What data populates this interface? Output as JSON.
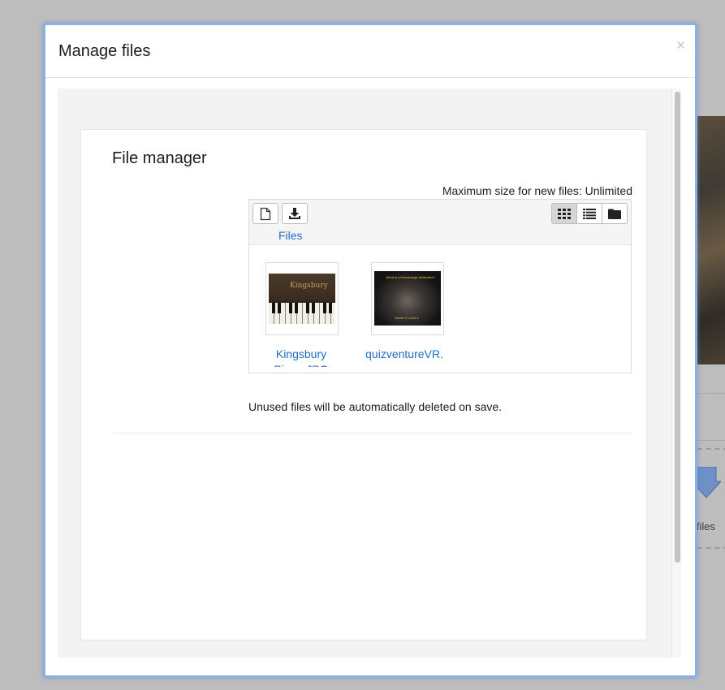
{
  "background": {
    "drop_text": "p files"
  },
  "modal": {
    "title": "Manage files",
    "close_label": "×"
  },
  "file_manager": {
    "title": "File manager",
    "max_size_text": "Maximum size for new files: Unlimited",
    "toolbar": {
      "add_icon": "file-icon",
      "download_icon": "download-icon",
      "view_modes": [
        {
          "icon": "grid-icon",
          "active": true
        },
        {
          "icon": "list-icon",
          "active": false
        },
        {
          "icon": "folder-icon",
          "active": false
        }
      ]
    },
    "breadcrumb": "Files",
    "files": [
      {
        "name": "Kingsbury Piano.JPG",
        "thumb_brand": "Kingsbury"
      },
      {
        "name": "quizventureVR.",
        "thumb_top": "What is a Kinesiologic Motivation?",
        "thumb_bottom": "Scene 3: Level 1"
      }
    ],
    "note": "Unused files will be automatically deleted on save."
  },
  "colors": {
    "link": "#1f6fc5",
    "modal_border": "#8bb1e3",
    "overlay": "#bdbdbd"
  }
}
